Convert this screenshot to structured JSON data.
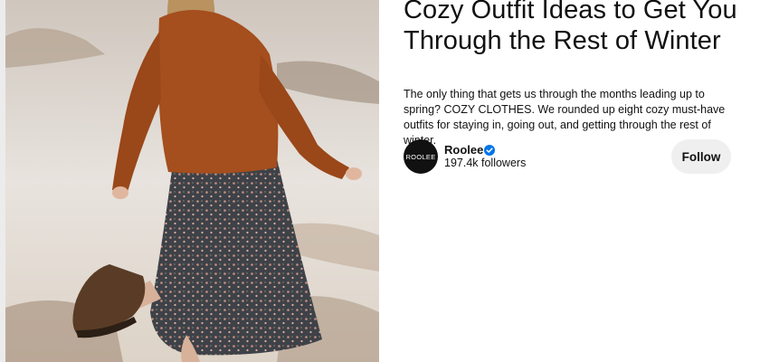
{
  "pin": {
    "title": "Cozy Outfit Ideas to Get You Through the Rest of Winter",
    "description": "The only thing that gets us through the months leading up to spring? COZY CLOTHES. We rounded up eight cozy must-have outfits for staying in, going out, and getting through the rest of winter."
  },
  "creator": {
    "avatar_text": "ROOLEE",
    "name": "Roolee",
    "verified": true,
    "followers": "197.4k followers"
  },
  "actions": {
    "follow_label": "Follow"
  },
  "icons": {
    "verified": "verified-check-icon"
  },
  "colors": {
    "verified_badge": "#0074e8",
    "follow_button_bg": "#efefef",
    "text": "#111111"
  }
}
